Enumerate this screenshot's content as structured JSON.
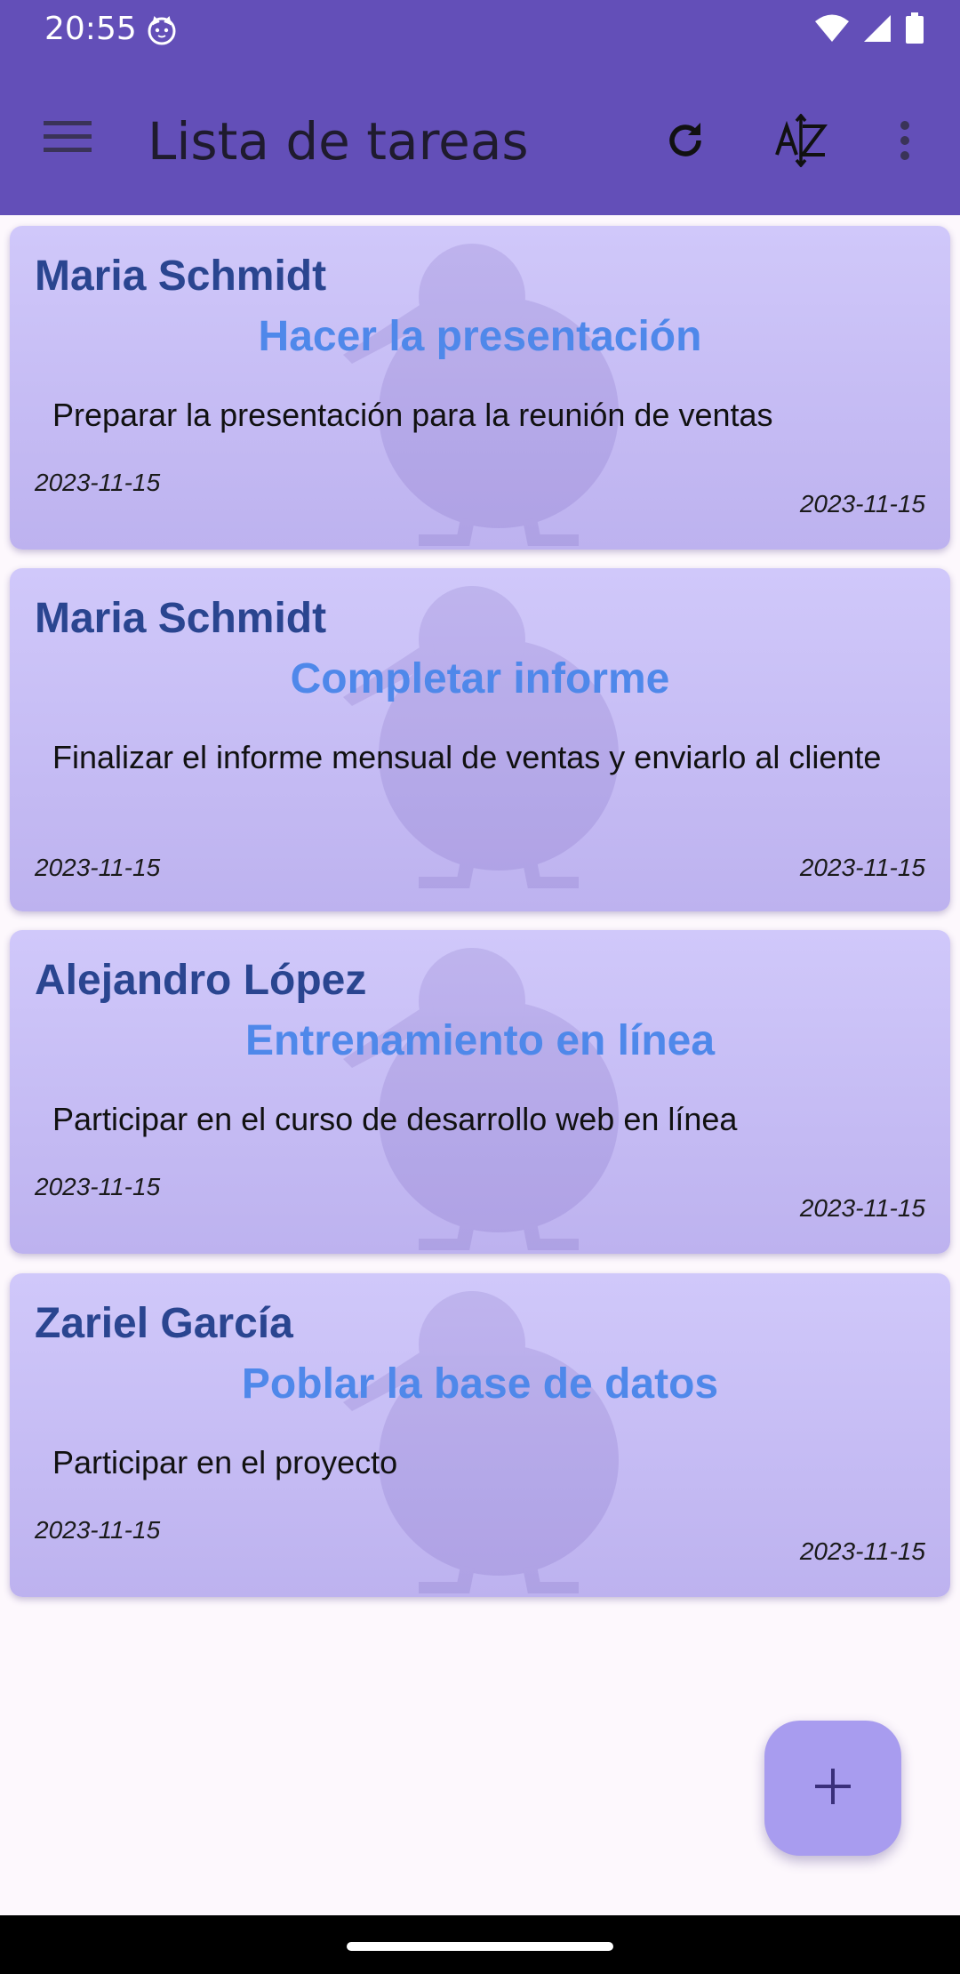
{
  "status_bar": {
    "time": "20:55",
    "icons": [
      "cat-notification-icon",
      "wifi-icon",
      "cell-signal-icon",
      "battery-icon"
    ]
  },
  "app_bar": {
    "title": "Lista de tareas",
    "actions": [
      "menu-icon",
      "refresh-icon",
      "sort-az-icon",
      "more-vert-icon"
    ]
  },
  "tasks": [
    {
      "author": "Maria Schmidt",
      "title": "Hacer la presentación",
      "description": "Preparar la presentación para la reunión de ventas",
      "date_left": "2023-11-15",
      "date_right": "2023-11-15"
    },
    {
      "author": "Maria Schmidt",
      "title": "Completar informe",
      "description": "Finalizar el informe mensual de ventas y enviarlo al cliente",
      "date_left": "2023-11-15",
      "date_right": "2023-11-15"
    },
    {
      "author": "Alejandro López",
      "title": "Entrenamiento en línea",
      "description": "Participar en el curso de desarrollo web en línea",
      "date_left": "2023-11-15",
      "date_right": "2023-11-15"
    },
    {
      "author": "Zariel García",
      "title": "Poblar la base de datos",
      "description": "Participar en el proyecto",
      "date_left": "2023-11-15",
      "date_right": "2023-11-15"
    }
  ],
  "fab": {
    "icon": "add-icon"
  },
  "colors": {
    "app_bar": "#634fb8",
    "author_text": "#2a4590",
    "title_text": "#4f88ea",
    "card_top": "#d0c8fa",
    "card_bottom": "#bdb2ef",
    "fab": "#a89cef"
  }
}
